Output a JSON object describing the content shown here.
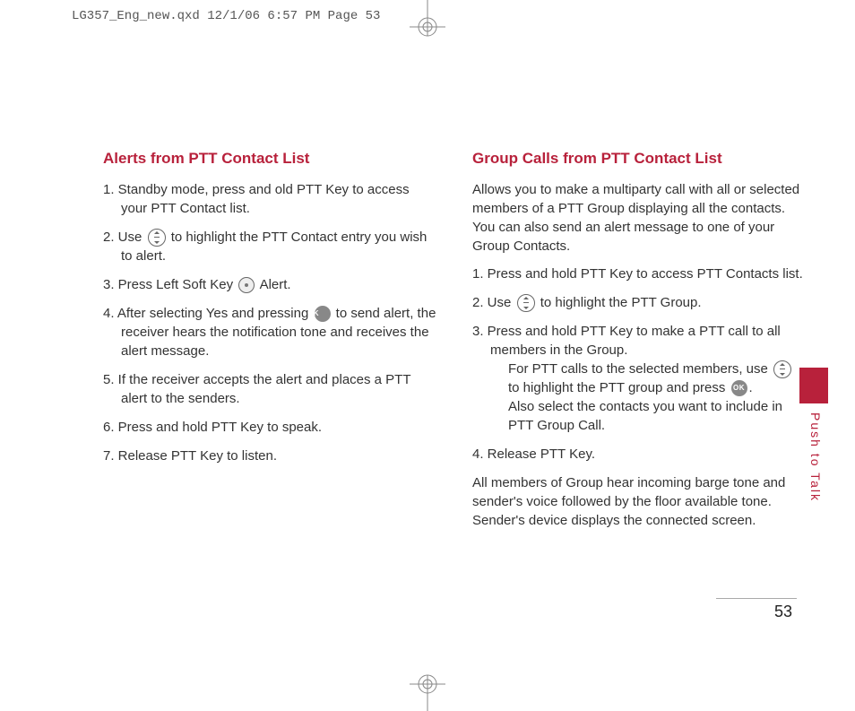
{
  "print_header": "LG357_Eng_new.qxd  12/1/06  6:57 PM  Page 53",
  "left": {
    "heading": "Alerts from PTT Contact List",
    "items": {
      "i1": "1. Standby mode, press and old PTT Key to access your PTT Contact list.",
      "i2a": "2. Use ",
      "i2b": " to highlight the PTT Contact entry you wish to alert.",
      "i3a": "3. Press Left Soft Key ",
      "i3b": " Alert.",
      "i4a": "4. After selecting Yes and pressing ",
      "i4b": " to send alert, the receiver hears the notification tone and receives the alert message.",
      "i5": "5. If the receiver accepts the alert and places a PTT alert to the senders.",
      "i6": "6. Press and hold PTT Key to speak.",
      "i7": "7.  Release PTT Key to listen."
    }
  },
  "right": {
    "heading": "Group Calls from PTT Contact List",
    "intro": "Allows you to make a multiparty call with all or selected members of a PTT Group displaying all the contacts. You can also send an alert message to one of your Group Contacts.",
    "items": {
      "i1": "1. Press and hold PTT Key to access PTT Contacts list.",
      "i2a": "2. Use ",
      "i2b": " to highlight the PTT Group.",
      "i3": "3. Press and hold PTT Key to make a PTT call to all members in the Group.",
      "i3suba": "For PTT calls to the selected members, use ",
      "i3subb": " to highlight the PTT group and press ",
      "i3subc": ".",
      "i3subd": "Also select the contacts you want to include in PTT Group Call.",
      "i4": "4. Release PTT Key."
    },
    "outro": "All members of Group hear incoming barge tone and sender's voice followed by the floor available tone. Sender's device displays the connected screen."
  },
  "side_label": "Push to Talk",
  "page_number": "53",
  "icons": {
    "ok_label": "OK"
  }
}
